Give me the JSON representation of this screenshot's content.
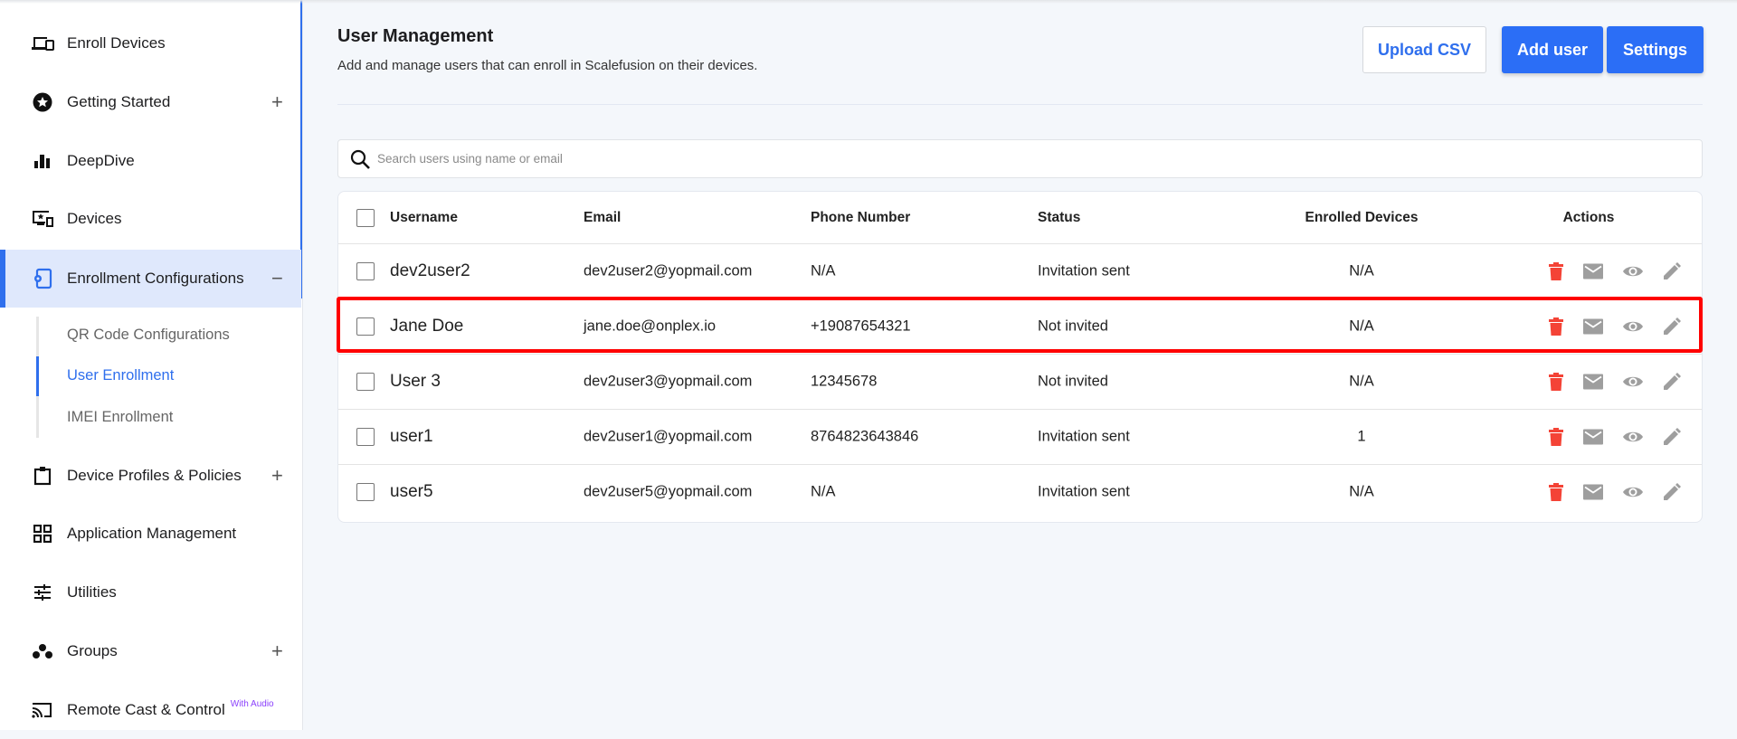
{
  "sidebar": {
    "items": [
      {
        "label": "Enroll Devices",
        "icon": "devices-icon"
      },
      {
        "label": "Getting Started",
        "icon": "star-circle-icon",
        "expand": "+"
      },
      {
        "label": "DeepDive",
        "icon": "bar-chart-icon"
      },
      {
        "label": "Devices",
        "icon": "monitor-star-icon"
      },
      {
        "label": "Enrollment Configurations",
        "icon": "enrollment-icon",
        "expand": "−"
      },
      {
        "label": "Device Profiles & Policies",
        "icon": "clipboard-icon",
        "expand": "+"
      },
      {
        "label": "Application Management",
        "icon": "grid-icon"
      },
      {
        "label": "Utilities",
        "icon": "sliders-icon"
      },
      {
        "label": "Groups",
        "icon": "groups-icon",
        "expand": "+"
      },
      {
        "label": "Remote Cast & Control",
        "icon": "cast-icon",
        "badge": "With Audio"
      }
    ],
    "sub_items": [
      "QR Code Configurations",
      "User Enrollment",
      "IMEI Enrollment"
    ]
  },
  "header": {
    "title": "User Management",
    "subtitle": "Add and manage users that can enroll in Scalefusion on their devices.",
    "upload_csv": "Upload CSV",
    "add_user": "Add user",
    "settings": "Settings"
  },
  "search": {
    "placeholder": "Search users using name or email",
    "value": ""
  },
  "table": {
    "columns": [
      "Username",
      "Email",
      "Phone Number",
      "Status",
      "Enrolled Devices",
      "Actions"
    ],
    "rows": [
      {
        "username": "dev2user2",
        "email": "dev2user2@yopmail.com",
        "phone": "N/A",
        "status": "Invitation sent",
        "devices": "N/A"
      },
      {
        "username": "Jane Doe",
        "email": "jane.doe@onplex.io",
        "phone": "+19087654321",
        "status": "Not invited",
        "devices": "N/A"
      },
      {
        "username": "User 3",
        "email": "dev2user3@yopmail.com",
        "phone": "12345678",
        "status": "Not invited",
        "devices": "N/A"
      },
      {
        "username": "user1",
        "email": "dev2user1@yopmail.com",
        "phone": "8764823643846",
        "status": "Invitation sent",
        "devices": "1"
      },
      {
        "username": "user5",
        "email": "dev2user5@yopmail.com",
        "phone": "N/A",
        "status": "Invitation sent",
        "devices": "N/A"
      }
    ]
  },
  "colors": {
    "accent": "#2b6ef6",
    "delete": "#f44336",
    "icon_gray": "#9e9e9e",
    "highlight": "#ff0000"
  }
}
